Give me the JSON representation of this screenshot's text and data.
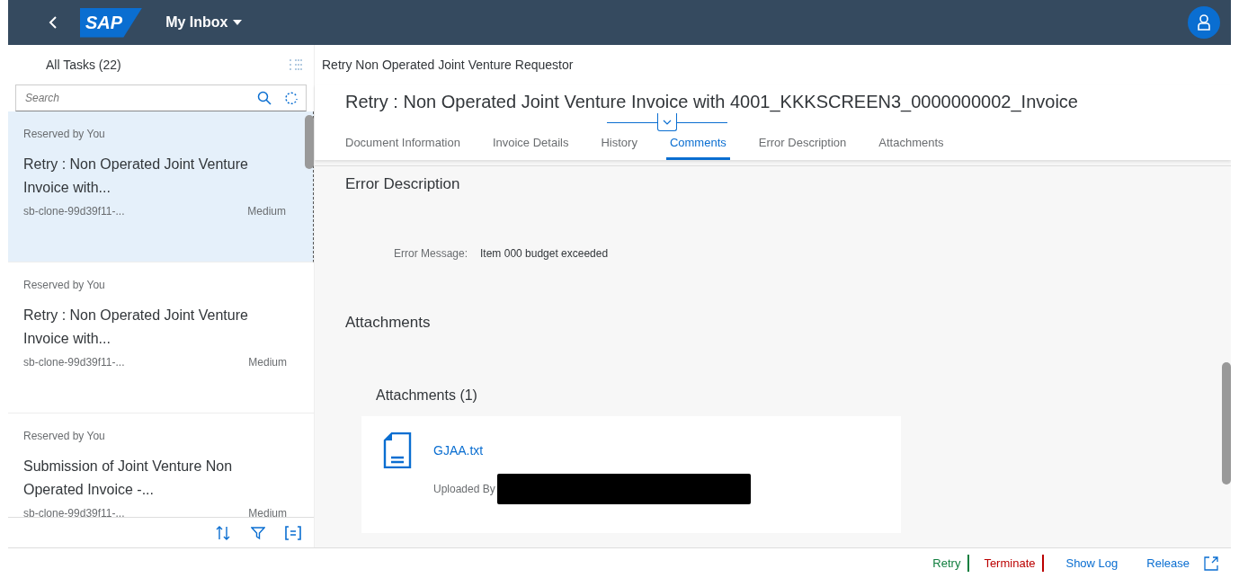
{
  "shell": {
    "title": "My Inbox",
    "logo": "SAP"
  },
  "master": {
    "title": "All Tasks (22)",
    "search": {
      "placeholder": "Search"
    },
    "items": [
      {
        "status": "Reserved by You",
        "title": "Retry : Non Operated Joint Venture Invoice with...",
        "id": "sb-clone-99d39f11-...",
        "priority": "Medium",
        "selected": true
      },
      {
        "status": "Reserved by You",
        "title": "Retry : Non Operated Joint Venture Invoice with...",
        "id": "sb-clone-99d39f11-...",
        "priority": "Medium",
        "selected": false
      },
      {
        "status": "Reserved by You",
        "title": "Submission of Joint Venture Non Operated Invoice -...",
        "id": "sb-clone-99d39f11-...",
        "priority": "Medium",
        "selected": false
      }
    ]
  },
  "detail": {
    "header": "Retry Non Operated Joint Venture Requestor",
    "title": "Retry : Non Operated Joint Venture Invoice with 4001_KKKSCREEN3_0000000002_Invoice",
    "tabs": [
      {
        "label": "Document Information",
        "selected": false
      },
      {
        "label": "Invoice Details",
        "selected": false
      },
      {
        "label": "History",
        "selected": false
      },
      {
        "label": "Comments",
        "selected": true
      },
      {
        "label": "Error Description",
        "selected": false
      },
      {
        "label": "Attachments",
        "selected": false
      }
    ],
    "error_section": {
      "title": "Error Description",
      "label": "Error Message:",
      "value": "Item 000 budget exceeded"
    },
    "attachments_section": {
      "title": "Attachments",
      "list_title": "Attachments (1)",
      "files": [
        {
          "name": "GJAA.txt",
          "uploaded_by_label": "Uploaded By"
        }
      ]
    }
  },
  "footer": {
    "actions": [
      {
        "label": "Retry",
        "kind": "positive"
      },
      {
        "label": "Terminate",
        "kind": "negative"
      },
      {
        "label": "Show Log",
        "kind": "plain"
      },
      {
        "label": "Release",
        "kind": "plain"
      }
    ]
  }
}
